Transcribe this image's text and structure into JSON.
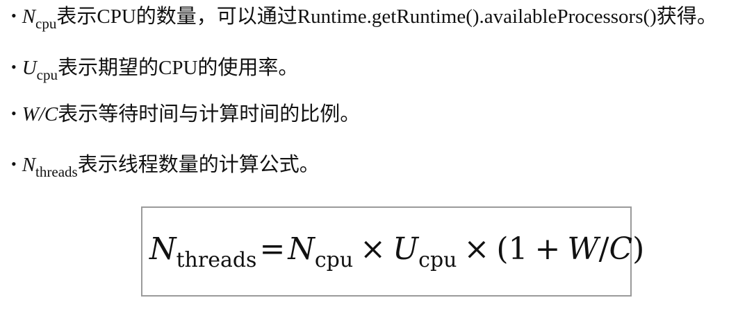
{
  "bullets": [
    {
      "symbol": "N",
      "subscript": "cpu",
      "text": "表示CPU的数量，可以通过Runtime.getRuntime().availableProcessors()获得。"
    },
    {
      "symbol": "U",
      "subscript": "cpu",
      "text": "表示期望的CPU的使用率。"
    },
    {
      "symbol": "W/C",
      "subscript": "",
      "text": "表示等待时间与计算时间的比例。"
    },
    {
      "symbol": "N",
      "subscript": "threads",
      "text": "表示线程数量的计算公式。"
    }
  ],
  "formula": {
    "lhs_symbol": "N",
    "lhs_sub": "threads",
    "equals": "=",
    "term1_symbol": "N",
    "term1_sub": "cpu",
    "times1": "×",
    "term2_symbol": "U",
    "term2_sub": "cpu",
    "times2": "×",
    "open_paren": "(",
    "one": "1",
    "plus": "+",
    "w": "W",
    "slash": "/",
    "c": "C",
    "close_paren": ")"
  }
}
